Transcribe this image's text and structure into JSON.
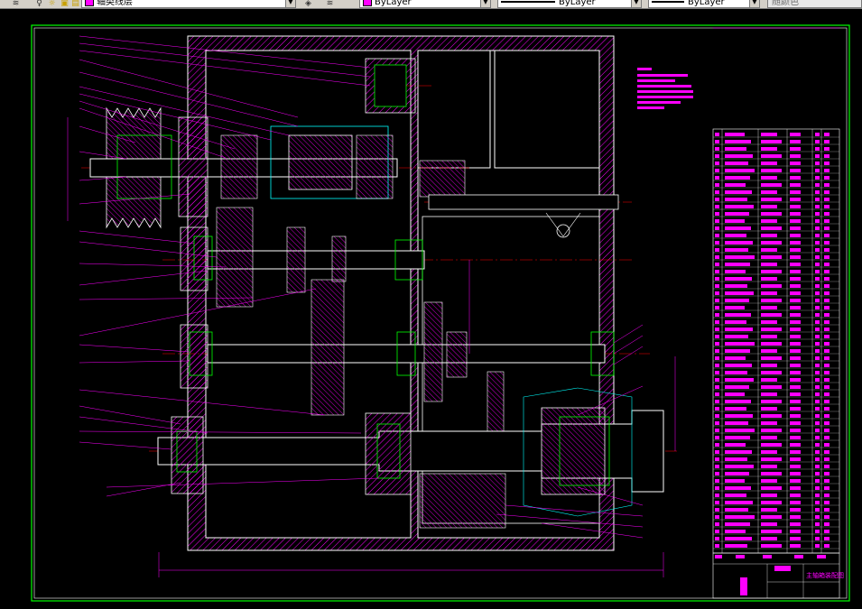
{
  "toolbar": {
    "layer_name": "轴类线层",
    "color_value": "ByLayer",
    "linetype_value": "ByLayer",
    "lineweight_value": "ByLayer",
    "plotstyle_value": "随颜色",
    "icons": [
      "layers-icon",
      "lightbulb-icon",
      "sun-icon",
      "lock-icon",
      "layer-color-icon",
      "make-current-icon",
      "layer-previous-icon"
    ],
    "colors": {
      "layer_swatch": "#ff00ff",
      "color_swatch": "#ff00ff"
    }
  },
  "drawing": {
    "title_block_name": "主轴箱装配图",
    "colors": {
      "background": "#000000",
      "outline": "#ffffff",
      "hatch": "#ff00ff",
      "center_line": "#ff0000",
      "dimension": "#00ff00",
      "leader": "#ff00ff",
      "hidden": "#00ffff"
    }
  }
}
